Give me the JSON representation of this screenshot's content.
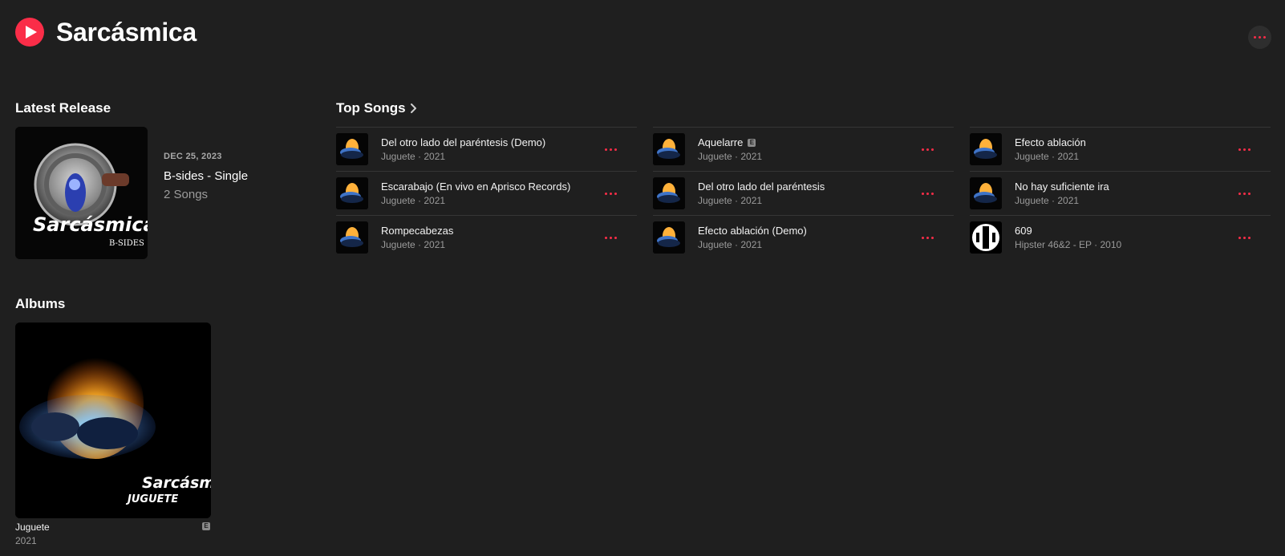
{
  "artist": {
    "name": "Sarcásmica"
  },
  "icons": {
    "play": "play-icon",
    "more": "more-dots-icon",
    "chevron": "chevron-right-icon"
  },
  "colors": {
    "accent": "#fa2d48",
    "background": "#1f1f1f"
  },
  "latest_release": {
    "heading": "Latest Release",
    "date": "DEC 25, 2023",
    "title": "B-sides - Single",
    "song_count": "2 Songs",
    "art_text": "Sarcásmica",
    "art_subtext": "B-SIDES"
  },
  "top_songs": {
    "heading": "Top Songs",
    "columns": [
      [
        {
          "title": "Del otro lado del paréntesis (Demo)",
          "subtitle": "Juguete · 2021"
        },
        {
          "title": "Escarabajo (En vivo en Aprisco Records)",
          "subtitle": "Juguete · 2021"
        },
        {
          "title": "Rompecabezas",
          "subtitle": "Juguete · 2021"
        }
      ],
      [
        {
          "title": "Aquelarre",
          "subtitle": "Juguete · 2021",
          "explicit": "E"
        },
        {
          "title": "Del otro lado del paréntesis",
          "subtitle": "Juguete · 2021"
        },
        {
          "title": "Efecto ablación (Demo)",
          "subtitle": "Juguete · 2021"
        }
      ],
      [
        {
          "title": "Efecto ablación",
          "subtitle": "Juguete · 2021"
        },
        {
          "title": "No hay suficiente ira",
          "subtitle": "Juguete · 2021"
        },
        {
          "title": "609",
          "subtitle": "Hipster 46&2 - EP · 2010"
        }
      ]
    ]
  },
  "albums": {
    "heading": "Albums",
    "items": [
      {
        "title": "Juguete",
        "year": "2021",
        "explicit": "E",
        "art_text": "Sarcásmica",
        "art_subtext": "JUGUETE"
      }
    ]
  }
}
